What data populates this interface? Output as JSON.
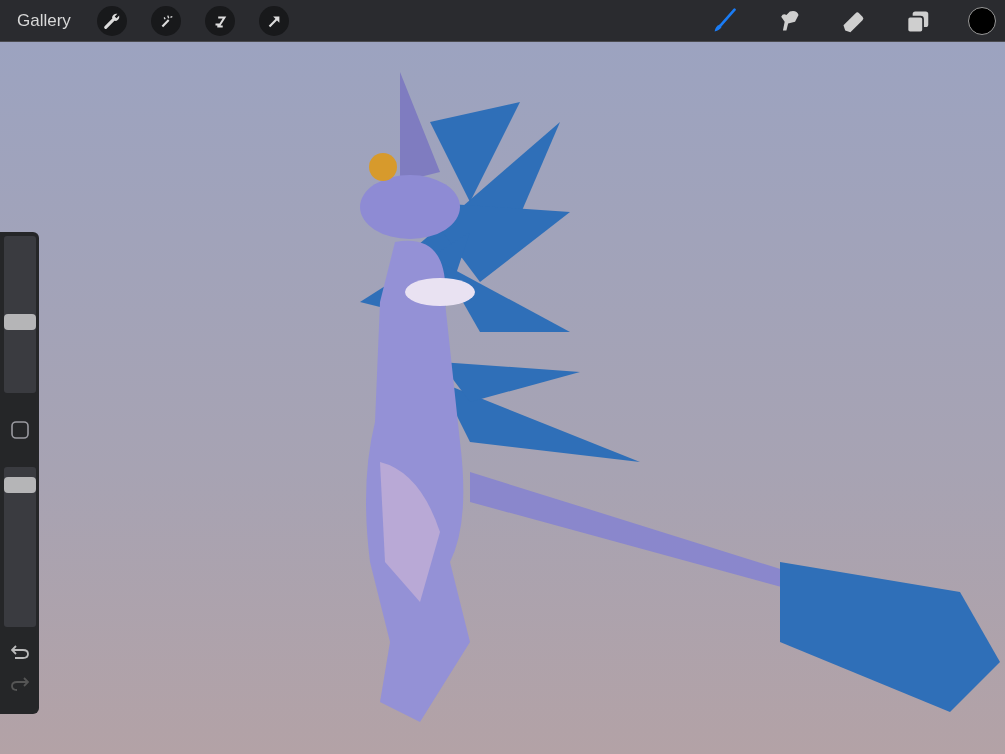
{
  "top_bar": {
    "gallery": "Gallery",
    "actions": [
      {
        "kind": "wrench"
      },
      {
        "kind": "wand"
      },
      {
        "kind": "selection"
      },
      {
        "kind": "arrow"
      }
    ],
    "tools": [
      {
        "kind": "brush",
        "selected": true
      },
      {
        "kind": "smudge",
        "selected": false
      },
      {
        "kind": "eraser",
        "selected": false
      },
      {
        "kind": "layers",
        "selected": false
      }
    ]
  },
  "sidebar": {
    "brush_size": {
      "level": 0.45
    },
    "opacity": {
      "level": 0.93
    },
    "undo": {
      "disabled": false
    },
    "redo": {
      "disabled": true
    }
  }
}
